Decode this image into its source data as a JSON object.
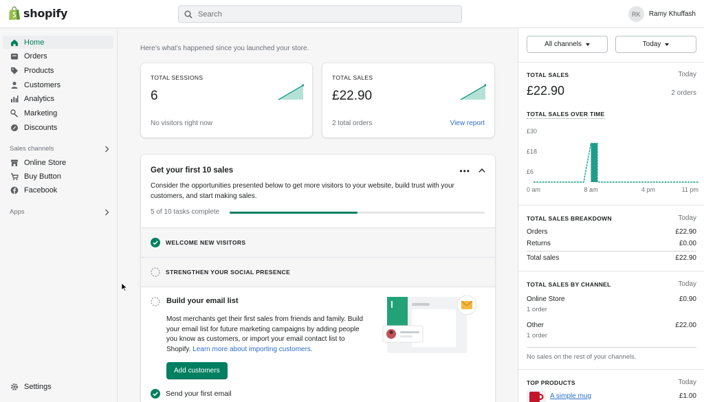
{
  "app": {
    "logo_text": "shopify",
    "search_placeholder": "Search",
    "user_initials": "RK",
    "user_name": "Ramy Khuffash",
    "brand_color": "#008060"
  },
  "sidebar": {
    "items": [
      {
        "label": "Home",
        "icon": "home-icon"
      },
      {
        "label": "Orders",
        "icon": "orders-icon"
      },
      {
        "label": "Products",
        "icon": "tag-icon"
      },
      {
        "label": "Customers",
        "icon": "person-icon"
      },
      {
        "label": "Analytics",
        "icon": "bar-chart-icon"
      },
      {
        "label": "Marketing",
        "icon": "megaphone-icon"
      },
      {
        "label": "Discounts",
        "icon": "discount-icon"
      }
    ],
    "sales_channels_label": "Sales channels",
    "channels": [
      {
        "label": "Online Store",
        "icon": "store-icon"
      },
      {
        "label": "Buy Button",
        "icon": "buy-button-icon"
      },
      {
        "label": "Facebook",
        "icon": "facebook-icon"
      }
    ],
    "apps_label": "Apps",
    "settings_label": "Settings"
  },
  "main": {
    "intro": "Here’s what’s happened since you launched your store.",
    "sessions": {
      "label": "TOTAL SESSIONS",
      "value": "6",
      "foot": "No visitors right now"
    },
    "sales": {
      "label": "TOTAL SALES",
      "value": "£22.90",
      "foot": "2 total orders",
      "link": "View report"
    },
    "tasks": {
      "title": "Get your first 10 sales",
      "description": "Consider the opportunities presented below to get more visitors to your website, build trust with your customers, and start making sales.",
      "progress_label": "5 of 10 tasks complete",
      "progress_fraction": 0.5,
      "items": [
        {
          "label": "WELCOME NEW VISITORS",
          "done": true
        },
        {
          "label": "STRENGTHEN YOUR SOCIAL PRESENCE",
          "done": false
        }
      ],
      "open_task": {
        "title": "Build your email list",
        "description": "Most merchants get their first sales from friends and family. Build your email list for future marketing campaigns by adding people you know as customers, or import your email contact list to Shopify.",
        "link": "Learn more about importing customers.",
        "button": "Add customers"
      },
      "next_task": "Send your first email"
    }
  },
  "right": {
    "channel_filter": "All channels",
    "date_filter": "Today",
    "total_sales": {
      "label": "TOTAL SALES",
      "period": "Today",
      "value": "£22.90",
      "orders": "2 orders",
      "over_time_label": "TOTAL SALES OVER TIME"
    },
    "breakdown": {
      "label": "TOTAL SALES BREAKDOWN",
      "period": "Today",
      "rows": [
        {
          "name": "Orders",
          "value": "£22.90"
        },
        {
          "name": "Returns",
          "value": "£0.00"
        }
      ],
      "total": {
        "name": "Total sales",
        "value": "£22.90"
      }
    },
    "by_channel": {
      "label": "TOTAL SALES BY CHANNEL",
      "period": "Today",
      "channels": [
        {
          "name": "Online Store",
          "value": "£0.90",
          "orders": "1 order"
        },
        {
          "name": "Other",
          "value": "£22.00",
          "orders": "1 order"
        }
      ],
      "note": "No sales on the rest of your channels."
    },
    "top_products": {
      "label": "TOP PRODUCTS",
      "period": "Today",
      "items": [
        {
          "name": "A simple mug",
          "value": "£1.00"
        }
      ]
    }
  },
  "chart_data": {
    "type": "line",
    "title": "TOTAL SALES OVER TIME",
    "x_tick_labels": [
      "0 am",
      "8 am",
      "4 pm",
      "11 pm"
    ],
    "y_tick_labels": [
      "£30",
      "£18",
      "£6"
    ],
    "ylim": [
      0,
      30
    ],
    "series": [
      {
        "values": [
          0,
          0,
          0,
          0,
          0,
          0,
          0,
          0,
          22.9,
          0,
          0,
          0,
          0,
          0,
          0,
          0,
          0,
          0,
          0,
          0,
          0,
          0,
          0,
          0
        ]
      }
    ],
    "color": "#1f9d8a"
  }
}
